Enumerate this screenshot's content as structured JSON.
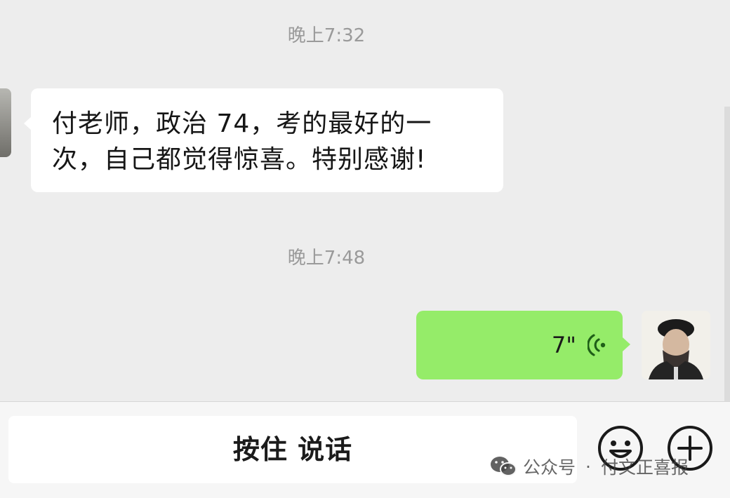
{
  "chat": {
    "timestamp_1": "晚上7:32",
    "incoming_message": "付老师，政治 74，考的最好的一次，自己都觉得惊喜。特别感谢!",
    "timestamp_2": "晚上7:48",
    "outgoing_voice_duration": "7\""
  },
  "input_bar": {
    "hold_to_talk_label": "按住 说话",
    "emoji_icon": "smiley-icon",
    "plus_icon": "plus-circle-icon"
  },
  "watermark": {
    "prefix": "公众号",
    "separator": "·",
    "name": "付文正喜报"
  },
  "colors": {
    "chat_background": "#ededed",
    "incoming_bubble": "#ffffff",
    "outgoing_bubble": "#95ec69",
    "timestamp_text": "#9a9a9a",
    "voice_icon": "#1f5f18"
  }
}
